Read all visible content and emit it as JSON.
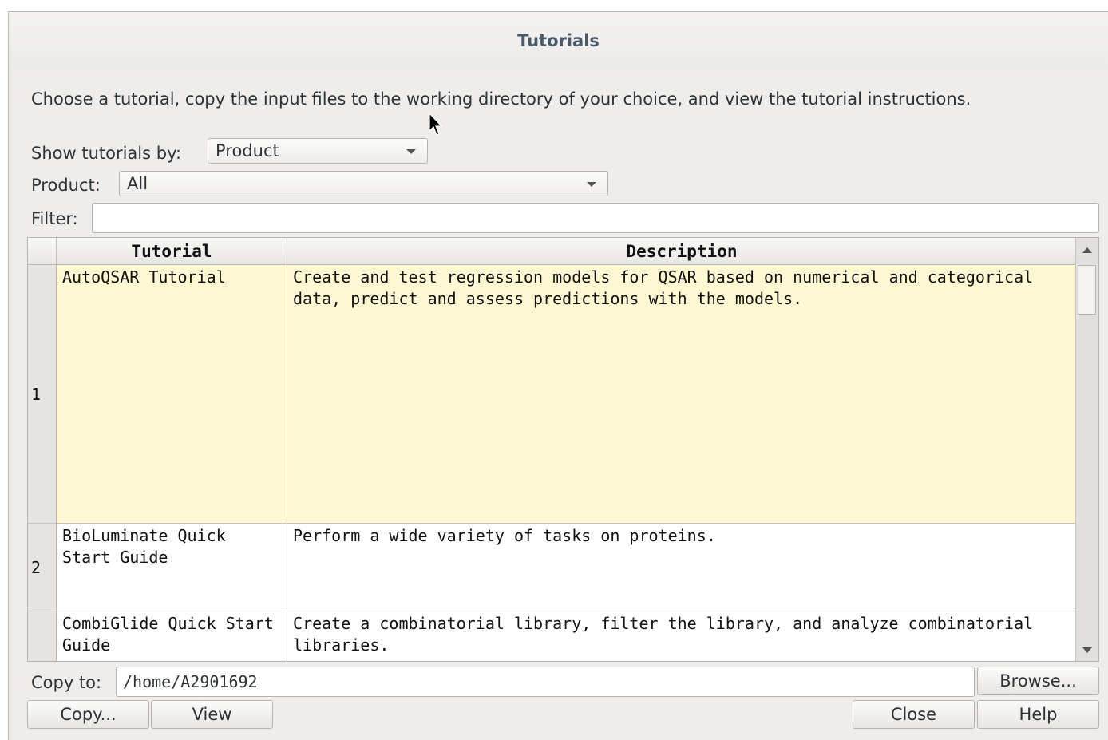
{
  "window": {
    "title": "Tutorials"
  },
  "instructions": "Choose a tutorial, copy the input files to the working directory of your choice, and view the tutorial instructions.",
  "show_by": {
    "label": "Show tutorials by:",
    "value": "Product"
  },
  "product": {
    "label": "Product:",
    "value": "All"
  },
  "filter": {
    "label": "Filter:",
    "value": ""
  },
  "table": {
    "columns": [
      "Tutorial",
      "Description"
    ],
    "rows": [
      {
        "num": "1",
        "tutorial": "AutoQSAR Tutorial",
        "description": "Create and test regression models for QSAR based on numerical and categorical data, predict and assess predictions with the models."
      },
      {
        "num": "2",
        "tutorial": "BioLuminate Quick Start Guide",
        "description": "Perform a wide variety of tasks on proteins."
      },
      {
        "num": "",
        "tutorial": "CombiGlide Quick Start Guide",
        "description": "Create a combinatorial library, filter the library, and analyze combinatorial libraries."
      }
    ]
  },
  "copy_to": {
    "label": "Copy to:",
    "value": "/home/A2901692",
    "browse_label": "Browse..."
  },
  "buttons": {
    "copy": "Copy...",
    "view": "View",
    "close": "Close",
    "help": "Help"
  }
}
